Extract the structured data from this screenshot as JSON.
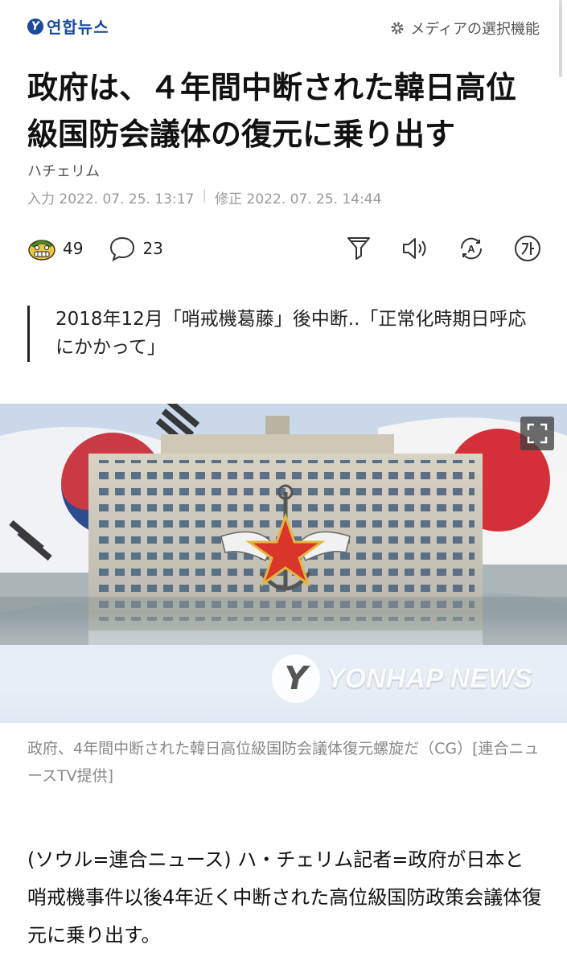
{
  "header": {
    "logo_mark": "Y",
    "logo_text": "연합뉴스",
    "media_select_label": "メディアの選択機能"
  },
  "article": {
    "headline": "政府は、４年間中断された韓日高位級国防会議体の復元に乗り出す",
    "byline": "ハチェリム",
    "input_label": "入力 2022. 07. 25. 13:17",
    "edit_label": "修正 2022. 07. 25. 14:44",
    "reactions": {
      "emoji_count": "49",
      "comment_count": "23"
    },
    "subhead": "2018年12月「哨戒機葛藤」後中断..「正常化時期日呼応にかかって」",
    "photo_watermark": "YONHAP NEWS",
    "caption": "政府、4年間中断された韓日高位級国防会議体復元螺旋だ（CG）[連合ニュースTV提供]",
    "body": "(ソウル=連合ニュース) ハ・チェリム記者=政府が日本と哨戒機事件以後4年近く中断された高位級国防政策会議体復元に乗り出す。"
  },
  "icons": [
    "gear-icon",
    "emoji-reaction-icon",
    "comment-icon",
    "recommend-icon",
    "audio-icon",
    "translate-icon",
    "font-size-icon",
    "expand-icon"
  ],
  "colors": {
    "brand": "#1a4a9c",
    "muted": "#999999",
    "caption": "#888888"
  }
}
